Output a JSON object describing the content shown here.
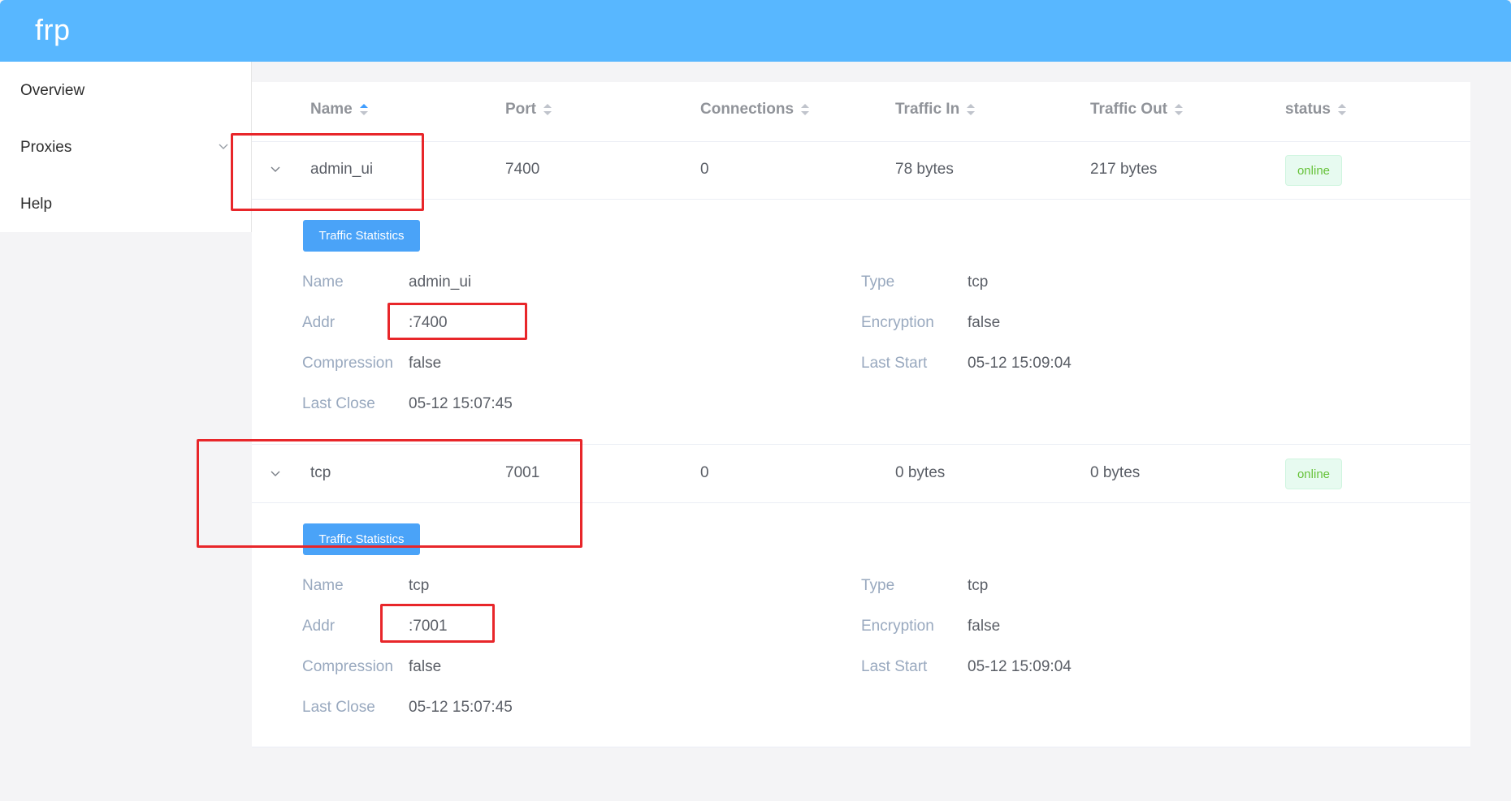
{
  "app": {
    "brand": "frp"
  },
  "sidebar": {
    "items": [
      {
        "label": "Overview"
      },
      {
        "label": "Proxies"
      },
      {
        "label": "Help"
      }
    ]
  },
  "table": {
    "columns": [
      "Name",
      "Port",
      "Connections",
      "Traffic In",
      "Traffic Out",
      "status"
    ],
    "rows": [
      {
        "name": "admin_ui",
        "port": "7400",
        "connections": "0",
        "traffic_in": "78 bytes",
        "traffic_out": "217 bytes",
        "status": "online",
        "button": "Traffic Statistics",
        "details": {
          "name_label": "Name",
          "name": "admin_ui",
          "addr_label": "Addr",
          "addr": ":7400",
          "compression_label": "Compression",
          "compression": "false",
          "last_close_label": "Last Close",
          "last_close": "05-12 15:07:45",
          "type_label": "Type",
          "type": "tcp",
          "encryption_label": "Encryption",
          "encryption": "false",
          "last_start_label": "Last Start",
          "last_start": "05-12 15:09:04"
        }
      },
      {
        "name": "tcp",
        "port": "7001",
        "connections": "0",
        "traffic_in": "0 bytes",
        "traffic_out": "0 bytes",
        "status": "online",
        "button": "Traffic Statistics",
        "details": {
          "name_label": "Name",
          "name": "tcp",
          "addr_label": "Addr",
          "addr": ":7001",
          "compression_label": "Compression",
          "compression": "false",
          "last_close_label": "Last Close",
          "last_close": "05-12 15:07:45",
          "type_label": "Type",
          "type": "tcp",
          "encryption_label": "Encryption",
          "encryption": "false",
          "last_start_label": "Last Start",
          "last_start": "05-12 15:09:04"
        }
      }
    ]
  },
  "colors": {
    "header": "#58b7ff",
    "button": "#4aa3f8",
    "status_online": "#67c23a",
    "annotation": "#e8262a"
  }
}
